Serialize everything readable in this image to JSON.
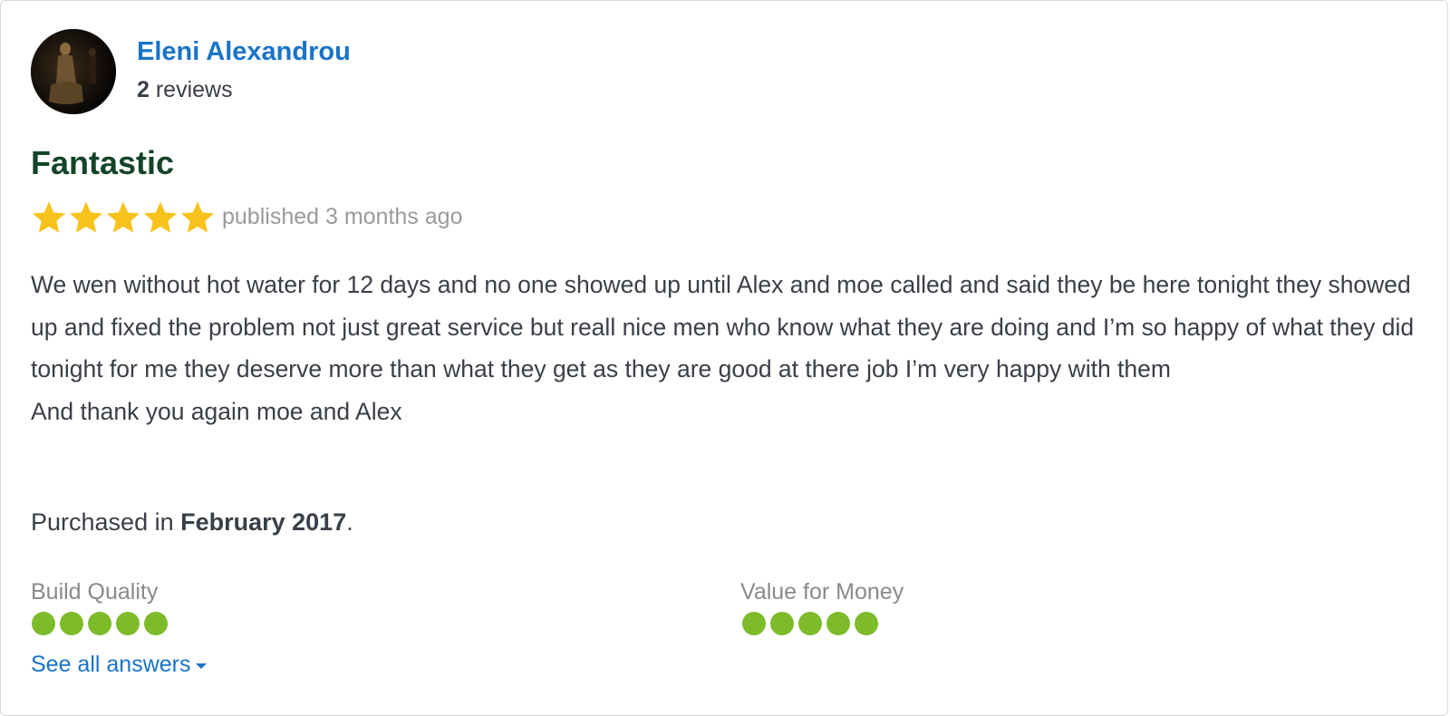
{
  "reviewer": {
    "name": "Eleni Alexandrou",
    "review_count": "2",
    "review_count_suffix": " reviews"
  },
  "review": {
    "title": "Fantastic",
    "rating": 5,
    "rating_max": 5,
    "published": "published 3 months ago",
    "body": "We wen without hot water for 12 days and no one showed up until Alex and moe called and said they be here tonight they showed up and fixed the problem not just great service but reall nice men who know what they are doing and I’m so happy of what they did tonight for me they deserve more than what they get as they are good at there job I’m very happy with them\nAnd thank you again moe and Alex",
    "purchased_prefix": "Purchased in ",
    "purchased_date": "February 2017",
    "purchased_suffix": "."
  },
  "attributes": [
    {
      "label": "Build Quality",
      "score": 5,
      "max": 5
    },
    {
      "label": "Value for Money",
      "score": 5,
      "max": 5
    }
  ],
  "actions": {
    "see_all": "See all answers"
  },
  "colors": {
    "link": "#1a73c8",
    "title": "#14432a",
    "star": "#f8c21c",
    "dot": "#7dbb2b",
    "muted": "#9a9a9a"
  }
}
